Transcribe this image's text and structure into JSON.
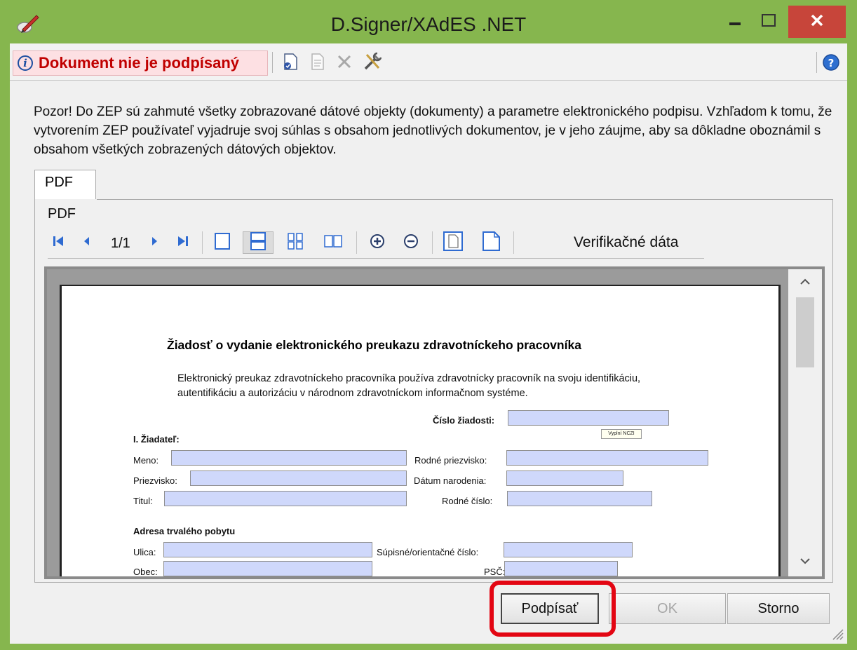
{
  "window": {
    "title": "D.Signer/XAdES .NET",
    "accent_color": "#86b64e",
    "close_color": "#c7453a",
    "icons": [
      "pen-icon",
      "minimize-icon",
      "maximize-icon",
      "close-icon"
    ]
  },
  "toolbar": {
    "status_text": "Dokument nie je podpísaný",
    "status_bg": "#fde0e3",
    "status_color": "#c00000",
    "icons": [
      "info-icon",
      "certificate-icon",
      "document-icon",
      "delete-icon",
      "settings-icon",
      "help-icon"
    ]
  },
  "notice": {
    "text": "Pozor! Do ZEP sú zahmuté všetky zobrazované dátové objekty (dokumenty) a parametre elektronického podpisu. Vzhľadom k tomu, že vytvorením ZEP používateľ vyjadruje svoj súhlas s obsahom jednotlivých dokumentov, je v jeho záujme, aby sa dôkladne oboznámil s obsahom všetkých zobrazených dátových objektov."
  },
  "tabs": [
    {
      "label": "PDF",
      "active": true
    }
  ],
  "viewer": {
    "label": "PDF",
    "page_indicator": "1/1",
    "verification_label": "Verifikačné dáta",
    "icons": [
      "first-page-icon",
      "prev-page-icon",
      "next-page-icon",
      "last-page-icon",
      "single-page-icon",
      "continuous-icon",
      "grid-icon",
      "two-page-icon",
      "zoom-in-icon",
      "zoom-out-icon",
      "fit-page-icon",
      "fit-width-icon"
    ]
  },
  "document": {
    "title": "Žiadosť o vydanie elektronického preukazu zdravotníckeho pracovníka",
    "intro": "Elektronický preukaz zdravotníckeho pracovníka používa zdravotnícky pracovník na svoju identifikáciu, autentifikáciu a autorizáciu v národnom zdravotníckom informačnom systéme.",
    "request_number_label": "Číslo žiadosti:",
    "tooltip": "Vyplní NCZI",
    "applicant_section": "I. Žiadateľ:",
    "fields": {
      "meno": "Meno:",
      "priezvisko": "Priezvisko:",
      "titul": "Titul:",
      "rodne_priezvisko": "Rodné priezvisko:",
      "datum_narodenia": "Dátum narodenia:",
      "rodne_cislo": "Rodné číslo:"
    },
    "address_section": "Adresa trvalého pobytu",
    "address_fields": {
      "ulica": "Ulica:",
      "supisne_cislo": "Súpisné/orientačné číslo:",
      "obec": "Obec:",
      "psc": "PSČ:"
    },
    "field_color": "#cfd8fb"
  },
  "buttons": {
    "sign": "Podpísať",
    "ok": "OK",
    "cancel": "Storno"
  },
  "highlight_color": "#e30613"
}
